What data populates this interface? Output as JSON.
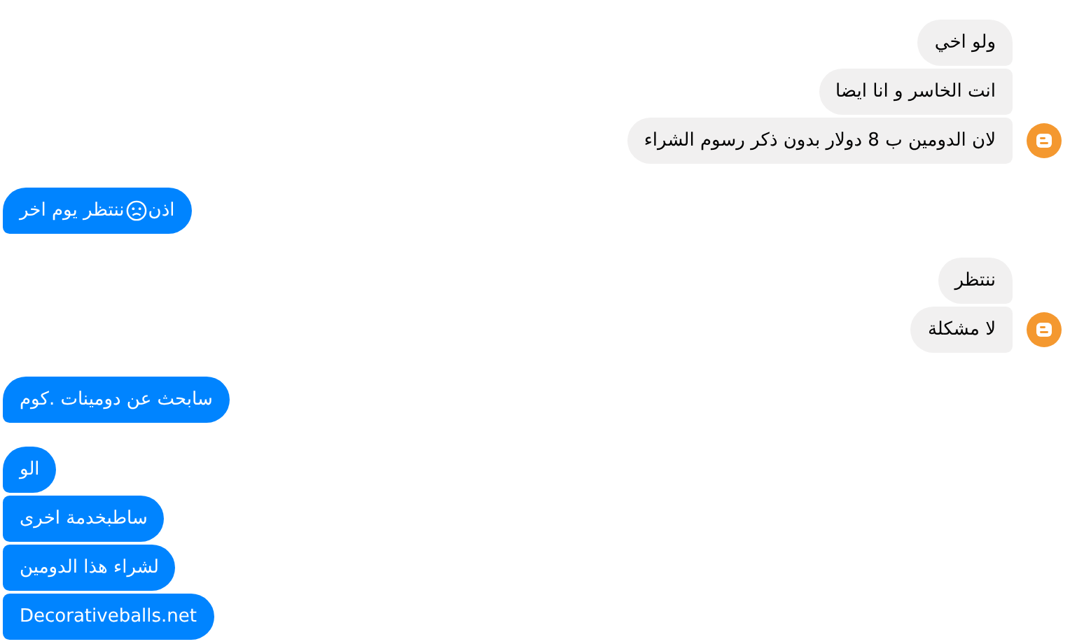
{
  "messages": [
    {
      "kind": "incoming",
      "bubbles": [
        {
          "text": "ولو اخي"
        },
        {
          "text": "انت الخاسر و انا ايضا"
        },
        {
          "text": "لان الدومين ب 8 دولار بدون ذكر رسوم الشراء"
        }
      ]
    },
    {
      "kind": "outgoing",
      "bubbles": [
        {
          "text": "اذن",
          "emoji": true,
          "text_after": "ننتظر  يوم اخر"
        }
      ]
    },
    {
      "kind": "incoming",
      "bubbles": [
        {
          "text": "ننتظر"
        },
        {
          "text": "لا مشكلة"
        }
      ]
    },
    {
      "kind": "outgoing",
      "bubbles": [
        {
          "text": "سابحث عن دومينات .كوم"
        }
      ]
    },
    {
      "kind": "outgoing",
      "bubbles": [
        {
          "text": "الو"
        },
        {
          "text": "ساطبخدمة  اخرى"
        },
        {
          "text": "لشراء هذا الدومين"
        },
        {
          "text": "Decorativeballs.net"
        }
      ]
    }
  ]
}
